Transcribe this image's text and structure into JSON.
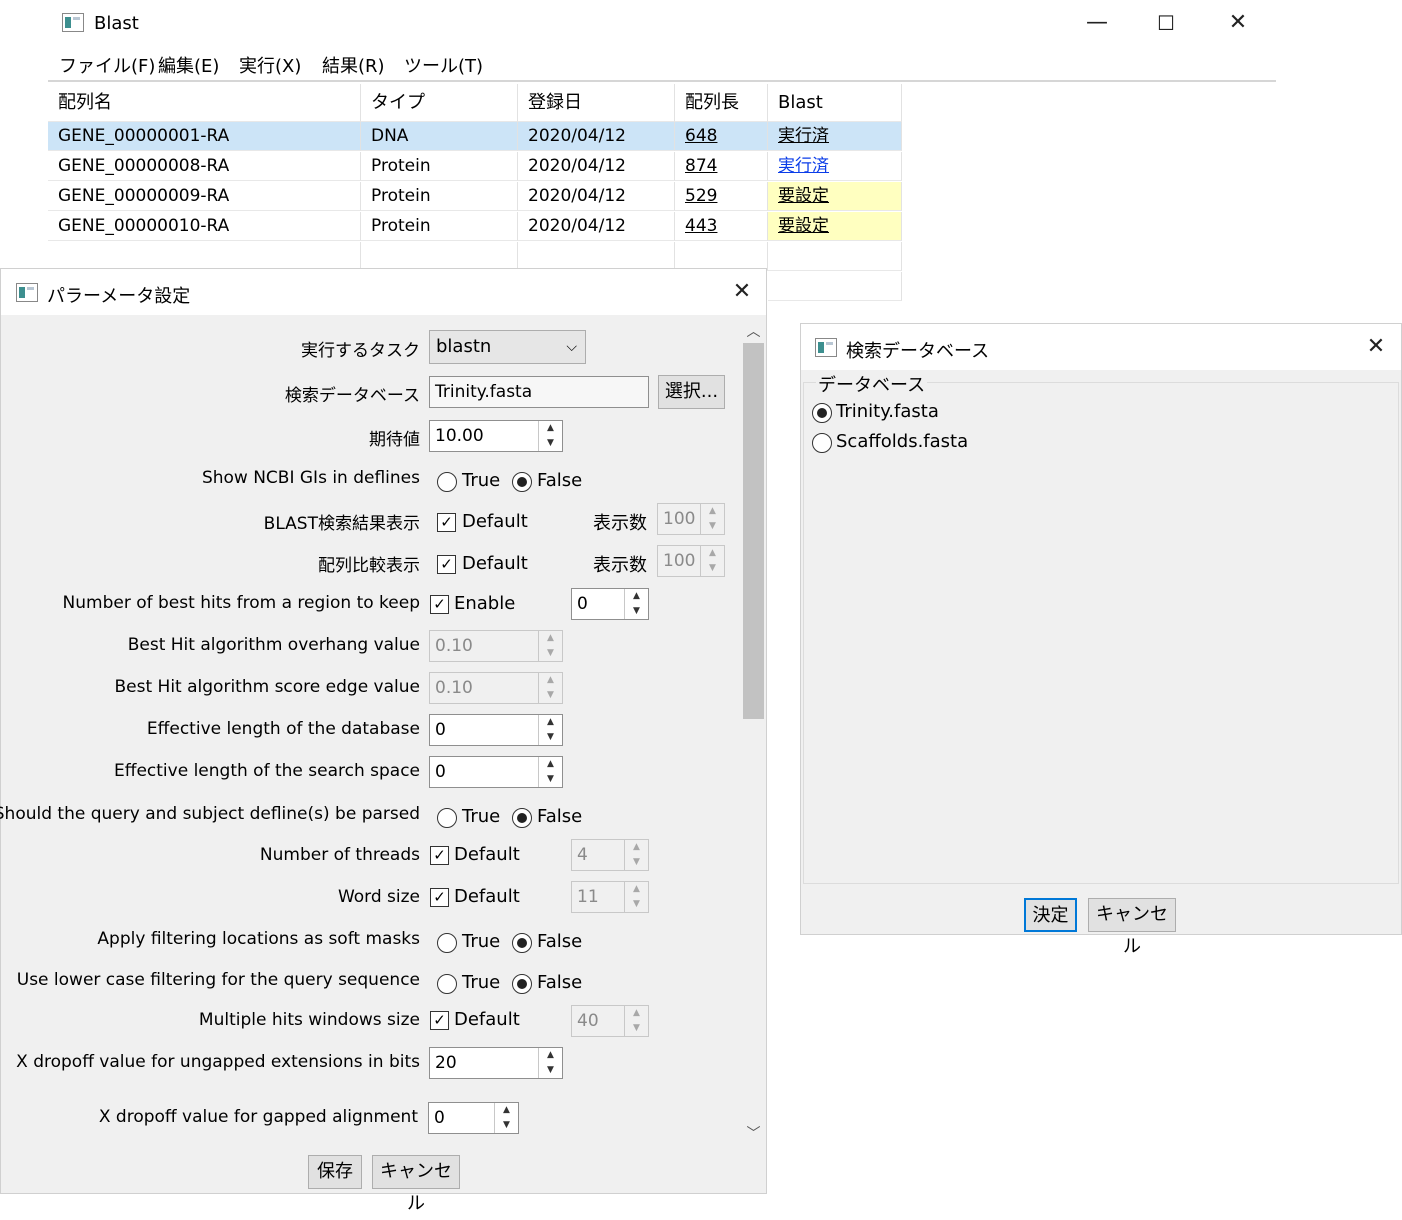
{
  "main_window": {
    "title": "Blast",
    "minimize_glyph": "—",
    "maximize_glyph": "☐",
    "close_glyph": "✕",
    "menu": [
      "ファイル(F)",
      "編集(E)",
      "実行(X)",
      "結果(R)",
      "ツール(T)"
    ],
    "columns": [
      "配列名",
      "タイプ",
      "登録日",
      "配列長",
      "Blast"
    ],
    "rows": [
      {
        "name": "GENE_00000001-RA",
        "type": "DNA",
        "date": "2020/04/12",
        "length": "648",
        "blast": "実行済"
      },
      {
        "name": "GENE_00000008-RA",
        "type": "Protein",
        "date": "2020/04/12",
        "length": "874",
        "blast": "実行済"
      },
      {
        "name": "GENE_00000009-RA",
        "type": "Protein",
        "date": "2020/04/12",
        "length": "529",
        "blast": "要設定"
      },
      {
        "name": "GENE_00000010-RA",
        "type": "Protein",
        "date": "2020/04/12",
        "length": "443",
        "blast": "要設定"
      }
    ],
    "colors": {
      "selected_row": "#cce4f7",
      "needs_setting": "#ffffc0",
      "link": "#0b3de8"
    }
  },
  "param_dialog": {
    "title": "パラーメータ設定",
    "close_glyph": "✕",
    "task_label": "実行するタスク",
    "task_value": "blastn",
    "db_label": "検索データベース",
    "db_value": "Trinity.fasta",
    "select_button": "選択...",
    "evalue_label": "期待値",
    "evalue_value": "10.00",
    "show_gi_label": "Show NCBI GIs in deflines",
    "true_label": "True",
    "false_label": "False",
    "blast_result_label": "BLAST検索結果表示",
    "default_label": "Default",
    "count_label": "表示数",
    "blast_result_count": "100",
    "alignment_label": "配列比較表示",
    "alignment_count": "100",
    "best_hits_label": "Number of best hits from a region to keep",
    "enable_label": "Enable",
    "best_hits_value": "0",
    "overhang_label": "Best Hit algorithm overhang value",
    "overhang_value": "0.10",
    "score_edge_label": "Best Hit algorithm score edge value",
    "score_edge_value": "0.10",
    "db_length_label": "Effective length of the database",
    "db_length_value": "0",
    "search_space_label": "Effective length of the search space",
    "search_space_value": "0",
    "parse_label": "Should the query and subject defline(s) be parsed",
    "threads_label": "Number of threads",
    "threads_value": "4",
    "word_size_label": "Word size",
    "word_size_value": "11",
    "soft_mask_label": "Apply filtering locations as soft masks",
    "lower_case_label": "Use lower case filtering for the query sequence",
    "window_size_label": "Multiple hits windows size",
    "window_size_value": "40",
    "xdrop_ungap_label": "X dropoff value for ungapped extensions in bits",
    "xdrop_ungap_value": "20",
    "xdrop_gap_label": "X dropoff value for gapped alignment",
    "xdrop_gap_value": "0",
    "save_button": "保存",
    "cancel_button": "キャンセル"
  },
  "db_dialog": {
    "title": "検索データベース",
    "close_glyph": "✕",
    "group_label": "データベース",
    "options": [
      "Trinity.fasta",
      "Scaffolds.fasta"
    ],
    "selected": "Trinity.fasta",
    "ok_button": "決定",
    "cancel_button": "キャンセル"
  }
}
